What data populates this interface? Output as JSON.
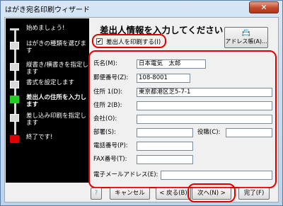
{
  "window": {
    "title": "はがき宛名印刷ウィザード",
    "close_symbol": "✕"
  },
  "steps": [
    {
      "label": "始めましょう!"
    },
    {
      "label": "はがきの種類を選びます"
    },
    {
      "label": "縦書き/横書きを指定します"
    },
    {
      "label": "書式を設定します"
    },
    {
      "label": "差出人の住所を入力します"
    },
    {
      "label": "差し込み印刷を指定します"
    },
    {
      "label": "終了です!"
    }
  ],
  "heading": "差出人情報を入力してください",
  "print_sender": {
    "label": "差出人を印刷する(I)",
    "checked_symbol": "✔"
  },
  "address_book_button": {
    "icon": "📇",
    "label": "アドレス帳(A)..."
  },
  "form": {
    "name": {
      "label": "氏名(M):",
      "value": "日本電気　太郎"
    },
    "postal": {
      "label": "郵便番号(Z):",
      "value": "108-8001"
    },
    "address1": {
      "label": "住所 1(D):",
      "value": "東京都港区芝5-7-1"
    },
    "address2": {
      "label": "住所 2(B):",
      "value": ""
    },
    "company": {
      "label": "会社(O):",
      "value": ""
    },
    "department": {
      "label": "部署(S):",
      "value": ""
    },
    "position": {
      "label": "役職(C):",
      "value": ""
    },
    "phone": {
      "label": "電話番号(P):",
      "value": ""
    },
    "fax": {
      "label": "FAX番号(T):",
      "value": ""
    },
    "email": {
      "label": "電子メールアドレス(E):",
      "value": ""
    }
  },
  "buttons": {
    "help": "?",
    "cancel": "キャンセル",
    "back": "< 戻る(B)",
    "next": "次へ(N) >",
    "finish": "完了(F)"
  },
  "colors": {
    "highlight": "#e00000",
    "current_step": "#22cc22",
    "end_step": "#e00000",
    "close_button": "#c24a2c"
  }
}
